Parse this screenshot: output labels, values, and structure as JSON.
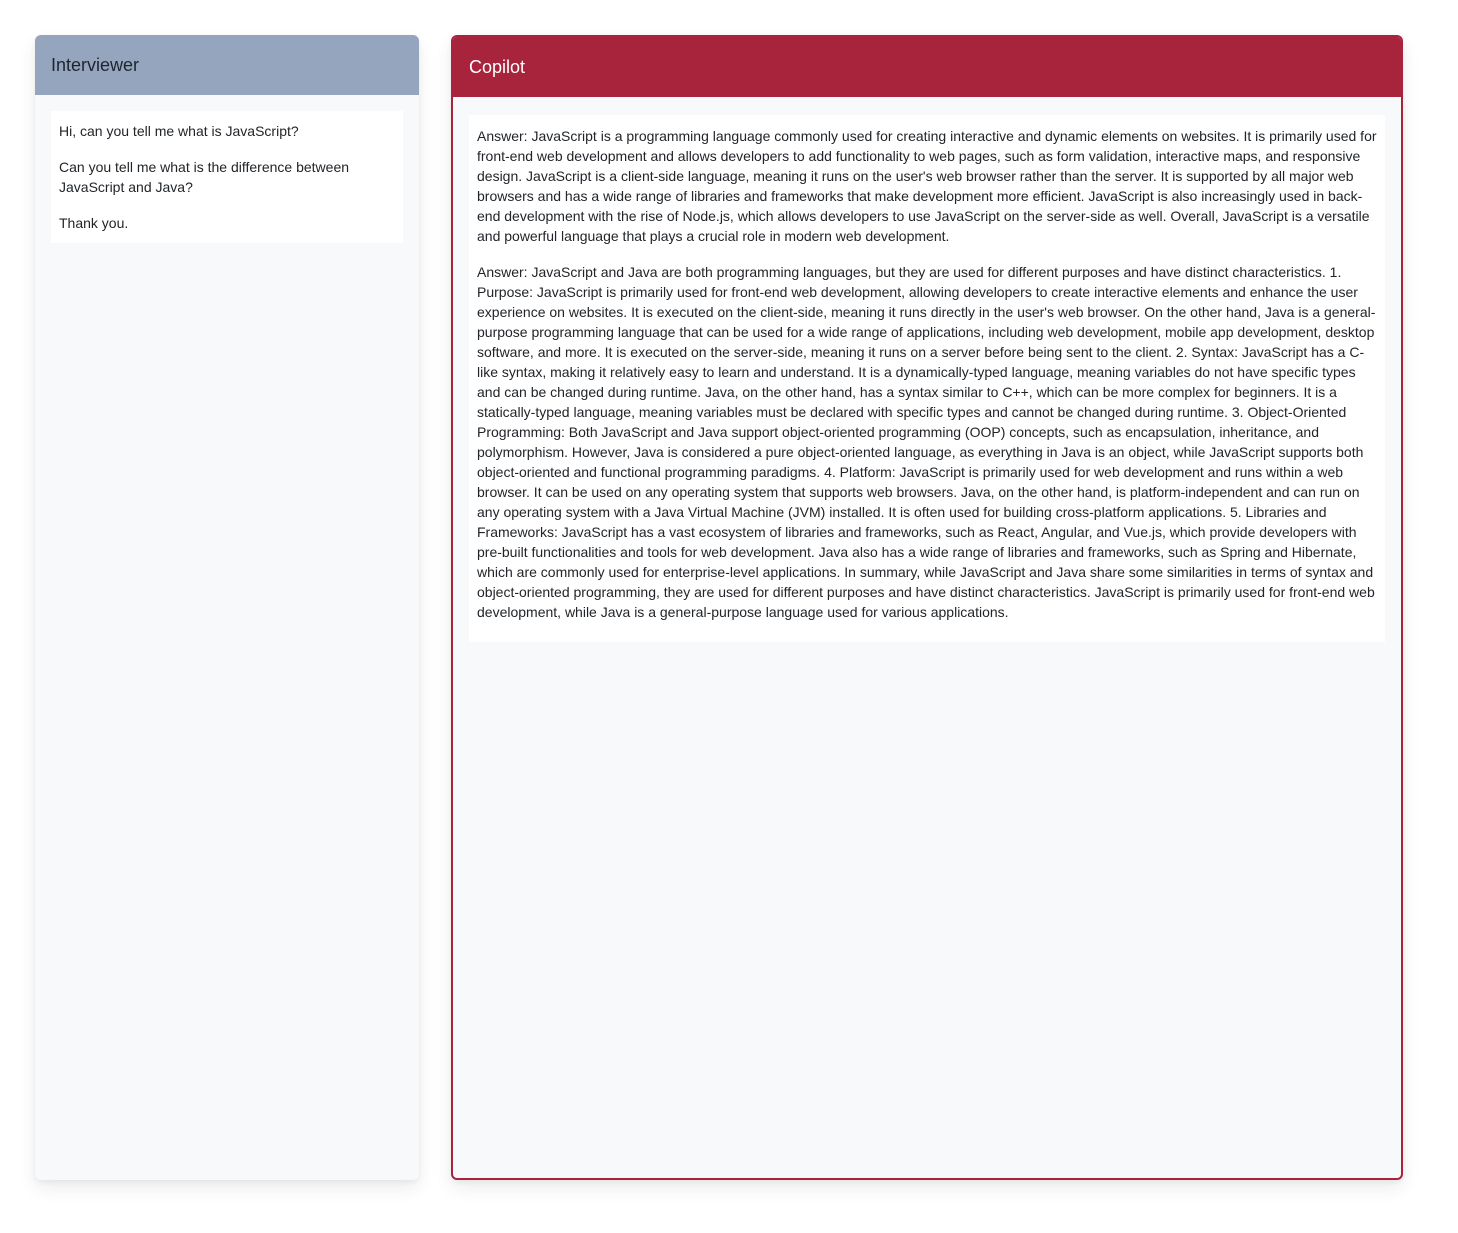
{
  "interviewer": {
    "title": "Interviewer",
    "messages": [
      "Hi, can you tell me what is JavaScript?",
      "Can you tell me what is the difference between JavaScript and Java?",
      "Thank you."
    ]
  },
  "copilot": {
    "title": "Copilot",
    "messages": [
      "Answer: JavaScript is a programming language commonly used for creating interactive and dynamic elements on websites. It is primarily used for front-end web development and allows developers to add functionality to web pages, such as form validation, interactive maps, and responsive design. JavaScript is a client-side language, meaning it runs on the user's web browser rather than the server. It is supported by all major web browsers and has a wide range of libraries and frameworks that make development more efficient. JavaScript is also increasingly used in back-end development with the rise of Node.js, which allows developers to use JavaScript on the server-side as well. Overall, JavaScript is a versatile and powerful language that plays a crucial role in modern web development.",
      "Answer: JavaScript and Java are both programming languages, but they are used for different purposes and have distinct characteristics. 1. Purpose: JavaScript is primarily used for front-end web development, allowing developers to create interactive elements and enhance the user experience on websites. It is executed on the client-side, meaning it runs directly in the user's web browser. On the other hand, Java is a general-purpose programming language that can be used for a wide range of applications, including web development, mobile app development, desktop software, and more. It is executed on the server-side, meaning it runs on a server before being sent to the client. 2. Syntax: JavaScript has a C-like syntax, making it relatively easy to learn and understand. It is a dynamically-typed language, meaning variables do not have specific types and can be changed during runtime. Java, on the other hand, has a syntax similar to C++, which can be more complex for beginners. It is a statically-typed language, meaning variables must be declared with specific types and cannot be changed during runtime. 3. Object-Oriented Programming: Both JavaScript and Java support object-oriented programming (OOP) concepts, such as encapsulation, inheritance, and polymorphism. However, Java is considered a pure object-oriented language, as everything in Java is an object, while JavaScript supports both object-oriented and functional programming paradigms. 4. Platform: JavaScript is primarily used for web development and runs within a web browser. It can be used on any operating system that supports web browsers. Java, on the other hand, is platform-independent and can run on any operating system with a Java Virtual Machine (JVM) installed. It is often used for building cross-platform applications. 5. Libraries and Frameworks: JavaScript has a vast ecosystem of libraries and frameworks, such as React, Angular, and Vue.js, which provide developers with pre-built functionalities and tools for web development. Java also has a wide range of libraries and frameworks, such as Spring and Hibernate, which are commonly used for enterprise-level applications. In summary, while JavaScript and Java share some similarities in terms of syntax and object-oriented programming, they are used for different purposes and have distinct characteristics. JavaScript is primarily used for front-end web development, while Java is a general-purpose language used for various applications."
    ]
  },
  "colors": {
    "interviewer_header": "#95a5bd",
    "copilot_accent": "#a8243d",
    "panel_background": "#f8f9fa"
  }
}
